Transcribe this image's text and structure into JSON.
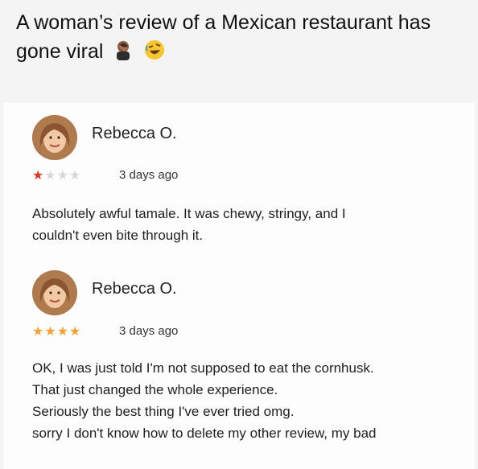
{
  "header": {
    "title": "A woman’s review of a Mexican restaurant has gone viral",
    "emojis": [
      "facepalm-emoji",
      "rofl-emoji"
    ]
  },
  "reviews": [
    {
      "name": "Rebecca O.",
      "rating": 1,
      "max_rating": 4,
      "star_color": "#d93a28",
      "date": "3 days ago",
      "lines": [
        "Absolutely awful tamale. It was chewy, stringy, and I",
        "couldn't even bite through it."
      ]
    },
    {
      "name": "Rebecca O.",
      "rating": 4,
      "max_rating": 4,
      "star_color": "#f2a23a",
      "date": "3 days ago",
      "lines": [
        "OK, I was just told I'm not supposed to eat the cornhusk.",
        "That just changed the whole experience.",
        "Seriously the best thing I've ever tried omg.",
        "sorry I don't know how to delete my other review, my bad"
      ]
    }
  ]
}
